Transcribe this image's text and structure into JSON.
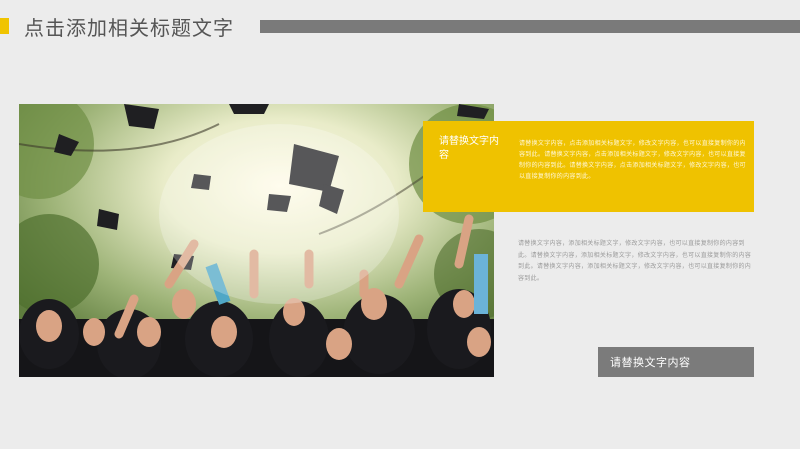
{
  "slide": {
    "title": "点击添加相关标题文字",
    "colors": {
      "accent": "#f0c400",
      "bar": "#7a7a7a",
      "background": "#ececec"
    }
  },
  "yellow_box": {
    "title": "请替换文字内容",
    "body": "请替换文字内容，点击添加相关标题文字，修改文字内容，也可以直接复制你的内容到此。请替换文字内容，点击添加相关标题文字，修改文字内容，也可以直接复制你的内容到此。请替换文字内容，点击添加相关标题文字，修改文字内容，也可以直接复制你的内容到此。"
  },
  "body_text": "请替换文字内容，添加相关标题文字，修改文字内容，也可以直接复制你的内容到此。请替换文字内容，添加相关标题文字，修改文字内容，也可以直接复制你的内容到此。请替换文字内容，添加相关标题文字，修改文字内容，也可以直接复制你的内容到此。",
  "button": {
    "label": "请替换文字内容"
  }
}
